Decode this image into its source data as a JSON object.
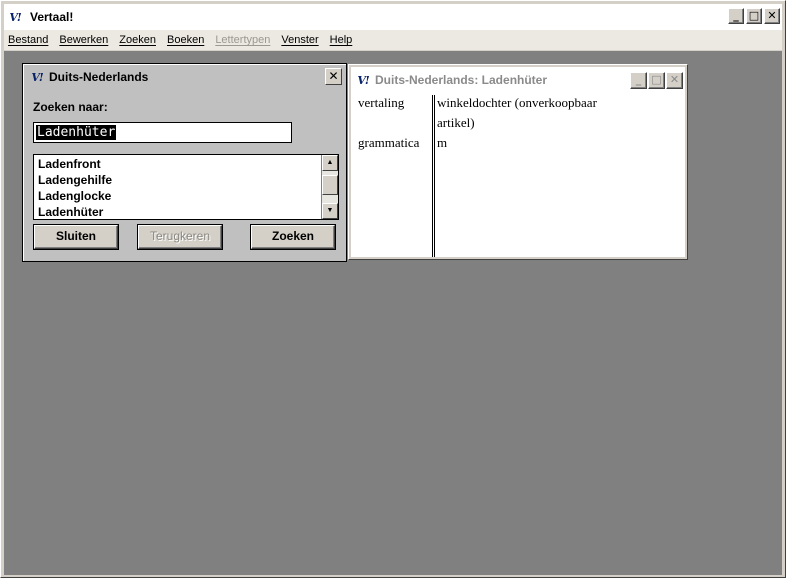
{
  "app": {
    "title": "Vertaal!",
    "logo": "V!",
    "window_buttons": {
      "minimize": "_",
      "maximize": "□",
      "close": "✕"
    }
  },
  "menu": [
    {
      "label": "Bestand",
      "enabled": true
    },
    {
      "label": "Bewerken",
      "enabled": true
    },
    {
      "label": "Zoeken",
      "enabled": true
    },
    {
      "label": "Boeken",
      "enabled": true
    },
    {
      "label": "Lettertypen",
      "enabled": false
    },
    {
      "label": "Venster",
      "enabled": true
    },
    {
      "label": "Help",
      "enabled": true
    }
  ],
  "search_dialog": {
    "title": "Duits-Nederlands",
    "close": "✕",
    "search_label": "Zoeken naar:",
    "search_value": "Ladenhüter",
    "list": [
      "Ladenfront",
      "Ladengehilfe",
      "Ladenglocke",
      "Ladenhüter"
    ],
    "buttons": {
      "close": "Sluiten",
      "back": "Terugkeren",
      "search": "Zoeken"
    }
  },
  "result_window": {
    "title": "Duits-Nederlands: Ladenhüter",
    "rows": [
      {
        "label": "vertaling",
        "value": "winkeldochter (onverkoopbaar artikel)"
      },
      {
        "label": "grammatica",
        "value": "m"
      }
    ]
  },
  "icons": {
    "scroll_up": "▲",
    "scroll_down": "▼"
  },
  "colors": {
    "workspace": "#808080",
    "dialog": "#c0c0c0",
    "chrome": "#d4d0c8"
  }
}
